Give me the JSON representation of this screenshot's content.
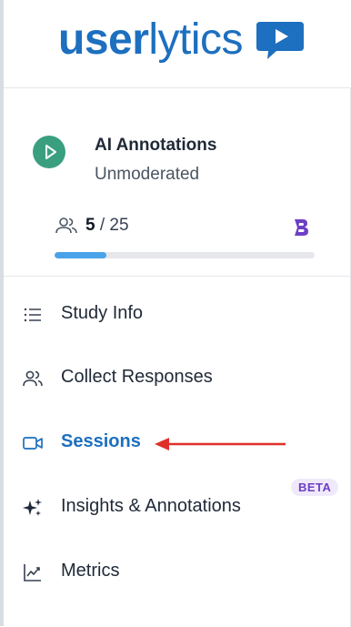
{
  "brand": {
    "logo_bold": "user",
    "logo_light": "lytics",
    "color": "#1d6fbf"
  },
  "study": {
    "title": "AI Annotations",
    "type": "Unmoderated",
    "participants_done": "5",
    "participants_separator": " / ",
    "participants_total": "25",
    "progress_fraction": 0.2,
    "avatar_color": "#3a9f7e"
  },
  "nav": {
    "items": [
      {
        "label": "Study Info",
        "icon": "list-icon",
        "active": false
      },
      {
        "label": "Collect Responses",
        "icon": "users-icon",
        "active": false
      },
      {
        "label": "Sessions",
        "icon": "video-camera-icon",
        "active": true
      },
      {
        "label": "Insights & Annotations",
        "icon": "sparkles-icon",
        "active": false,
        "badge": "BETA"
      },
      {
        "label": "Metrics",
        "icon": "chart-line-icon",
        "active": false
      }
    ]
  },
  "annotation": {
    "arrow_color": "#e0302a",
    "points_to": "Sessions"
  }
}
